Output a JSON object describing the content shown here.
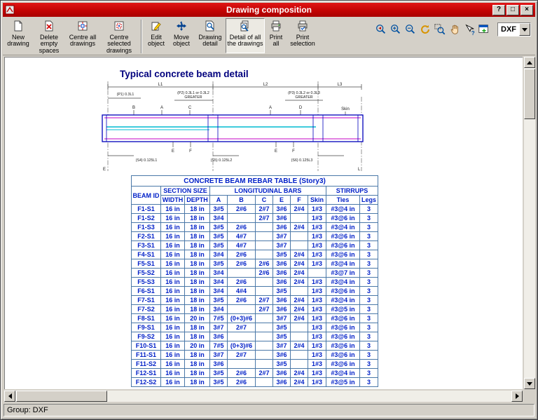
{
  "window": {
    "title": "Drawing composition",
    "help_glyph": "?",
    "maximize_glyph": "□",
    "close_glyph": "×",
    "status": "Group: DXF"
  },
  "toolbar": {
    "buttons": [
      "New drawing",
      "Delete empty spaces",
      "Centre all drawings",
      "Centre selected drawings",
      "Edit object",
      "Move object",
      "Drawing detail",
      "Detail of all the drawings",
      "Print all",
      "Print selection"
    ],
    "right_tools": [
      "zoom previous",
      "zoom in",
      "zoom out",
      "regenerate",
      "zoom window",
      "pan",
      "what is this",
      "export view"
    ],
    "format_value": "DXF"
  },
  "drawing": {
    "title": "Typical concrete beam detail",
    "l1": "L1",
    "l2": "L2",
    "l3": "L3",
    "p1": "(P1)  0.3L1",
    "p2a": "(P2)  0.3L1 or 0.3L2",
    "p2b": "GREATER",
    "p3a": "(P3)  0.3L2 or 0.3L3",
    "p3b": "GREATER",
    "b": "B",
    "a1": "A",
    "c": "C",
    "a2": "A",
    "d": "D",
    "skin": "Skin",
    "e1": "E",
    "f1": "F",
    "e2": "E",
    "f2": "F",
    "s4": "(S4)  0.125L1",
    "s5": "(S5)  0.125L2",
    "s6": "(S6)  0.125L3",
    "corner_e": "E",
    "corner_l": "L"
  },
  "table": {
    "title": "CONCRETE BEAM REBAR TABLE (Story3)",
    "group_beam": "BEAM ID",
    "group_section": "SECTION SIZE",
    "group_longitudinal": "LONGITUDINAL BARS",
    "group_stirrups": "STIRRUPS",
    "columns": [
      "WIDTH",
      "DEPTH",
      "A",
      "B",
      "C",
      "E",
      "F",
      "Skin",
      "Ties",
      "Legs"
    ],
    "rows": [
      [
        "F1-S1",
        "16 in",
        "18 in",
        "3#5",
        "2#6",
        "2#7",
        "3#6",
        "2#4",
        "1#3",
        "#3@4 in",
        "3"
      ],
      [
        "F1-S2",
        "16 in",
        "18 in",
        "3#4",
        "",
        "2#7",
        "3#6",
        "",
        "1#3",
        "#3@6 in",
        "3"
      ],
      [
        "F1-S3",
        "16 in",
        "18 in",
        "3#5",
        "2#6",
        "",
        "3#6",
        "2#4",
        "1#3",
        "#3@4 in",
        "3"
      ],
      [
        "F2-S1",
        "16 in",
        "18 in",
        "3#5",
        "4#7",
        "",
        "3#7",
        "",
        "1#3",
        "#3@6 in",
        "3"
      ],
      [
        "F3-S1",
        "16 in",
        "18 in",
        "3#5",
        "4#7",
        "",
        "3#7",
        "",
        "1#3",
        "#3@6 in",
        "3"
      ],
      [
        "F4-S1",
        "16 in",
        "18 in",
        "3#4",
        "2#6",
        "",
        "3#5",
        "2#4",
        "1#3",
        "#3@6 in",
        "3"
      ],
      [
        "F5-S1",
        "16 in",
        "18 in",
        "3#5",
        "2#6",
        "2#6",
        "3#6",
        "2#4",
        "1#3",
        "#3@4 in",
        "3"
      ],
      [
        "F5-S2",
        "16 in",
        "18 in",
        "3#4",
        "",
        "2#6",
        "3#6",
        "2#4",
        "",
        "#3@7 in",
        "3"
      ],
      [
        "F5-S3",
        "16 in",
        "18 in",
        "3#4",
        "2#6",
        "",
        "3#6",
        "2#4",
        "1#3",
        "#3@4 in",
        "3"
      ],
      [
        "F6-S1",
        "16 in",
        "18 in",
        "3#4",
        "4#4",
        "",
        "3#5",
        "",
        "1#3",
        "#3@6 in",
        "3"
      ],
      [
        "F7-S1",
        "16 in",
        "18 in",
        "3#5",
        "2#6",
        "2#7",
        "3#6",
        "2#4",
        "1#3",
        "#3@4 in",
        "3"
      ],
      [
        "F7-S2",
        "16 in",
        "18 in",
        "3#4",
        "",
        "2#7",
        "3#6",
        "2#4",
        "1#3",
        "#3@5 in",
        "3"
      ],
      [
        "F8-S1",
        "16 in",
        "20 in",
        "7#5",
        "(0+3)#6",
        "",
        "3#7",
        "2#4",
        "1#3",
        "#3@6 in",
        "3"
      ],
      [
        "F9-S1",
        "16 in",
        "18 in",
        "3#7",
        "2#7",
        "",
        "3#5",
        "",
        "1#3",
        "#3@6 in",
        "3"
      ],
      [
        "F9-S2",
        "16 in",
        "18 in",
        "3#6",
        "",
        "",
        "3#5",
        "",
        "1#3",
        "#3@6 in",
        "3"
      ],
      [
        "F10-S1",
        "16 in",
        "20 in",
        "7#5",
        "(0+3)#6",
        "",
        "3#7",
        "2#4",
        "1#3",
        "#3@6 in",
        "3"
      ],
      [
        "F11-S1",
        "16 in",
        "18 in",
        "3#7",
        "2#7",
        "",
        "3#6",
        "",
        "1#3",
        "#3@6 in",
        "3"
      ],
      [
        "F11-S2",
        "16 in",
        "18 in",
        "3#6",
        "",
        "",
        "3#5",
        "",
        "1#3",
        "#3@6 in",
        "3"
      ],
      [
        "F12-S1",
        "16 in",
        "18 in",
        "3#5",
        "2#6",
        "2#7",
        "3#6",
        "2#4",
        "1#3",
        "#3@4 in",
        "3"
      ],
      [
        "F12-S2",
        "16 in",
        "18 in",
        "3#5",
        "2#6",
        "",
        "3#6",
        "2#4",
        "1#3",
        "#3@5 in",
        "3"
      ]
    ]
  }
}
